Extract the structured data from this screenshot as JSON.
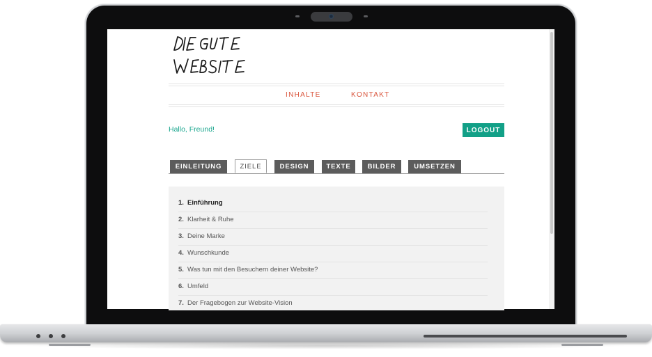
{
  "site": {
    "logo_text": "DIE GUTE WEBSITE",
    "nav": {
      "items": [
        "INHALTE",
        "KONTAKT"
      ]
    },
    "greeting": "Hallo, Freund!",
    "logout_label": "LOGOUT",
    "tabs": [
      "EINLEITUNG",
      "ZIELE",
      "DESIGN",
      "TEXTE",
      "BILDER",
      "UMSETZEN"
    ],
    "active_tab": "ZIELE",
    "chapters": [
      {
        "num": "1.",
        "label": "Einführung"
      },
      {
        "num": "2.",
        "label": "Klarheit & Ruhe"
      },
      {
        "num": "3.",
        "label": "Deine Marke"
      },
      {
        "num": "4.",
        "label": "Wunschkunde"
      },
      {
        "num": "5.",
        "label": "Was tun mit den Besuchern deiner Website?"
      },
      {
        "num": "6.",
        "label": "Umfeld"
      },
      {
        "num": "7.",
        "label": "Der Fragebogen zur Website-Vision"
      }
    ],
    "current_chapter": "Einführung"
  },
  "colors": {
    "accent_red": "#d9533a",
    "accent_teal": "#12a087",
    "tab_gray": "#5c5c5c",
    "panel_bg": "#f2f2f2"
  }
}
